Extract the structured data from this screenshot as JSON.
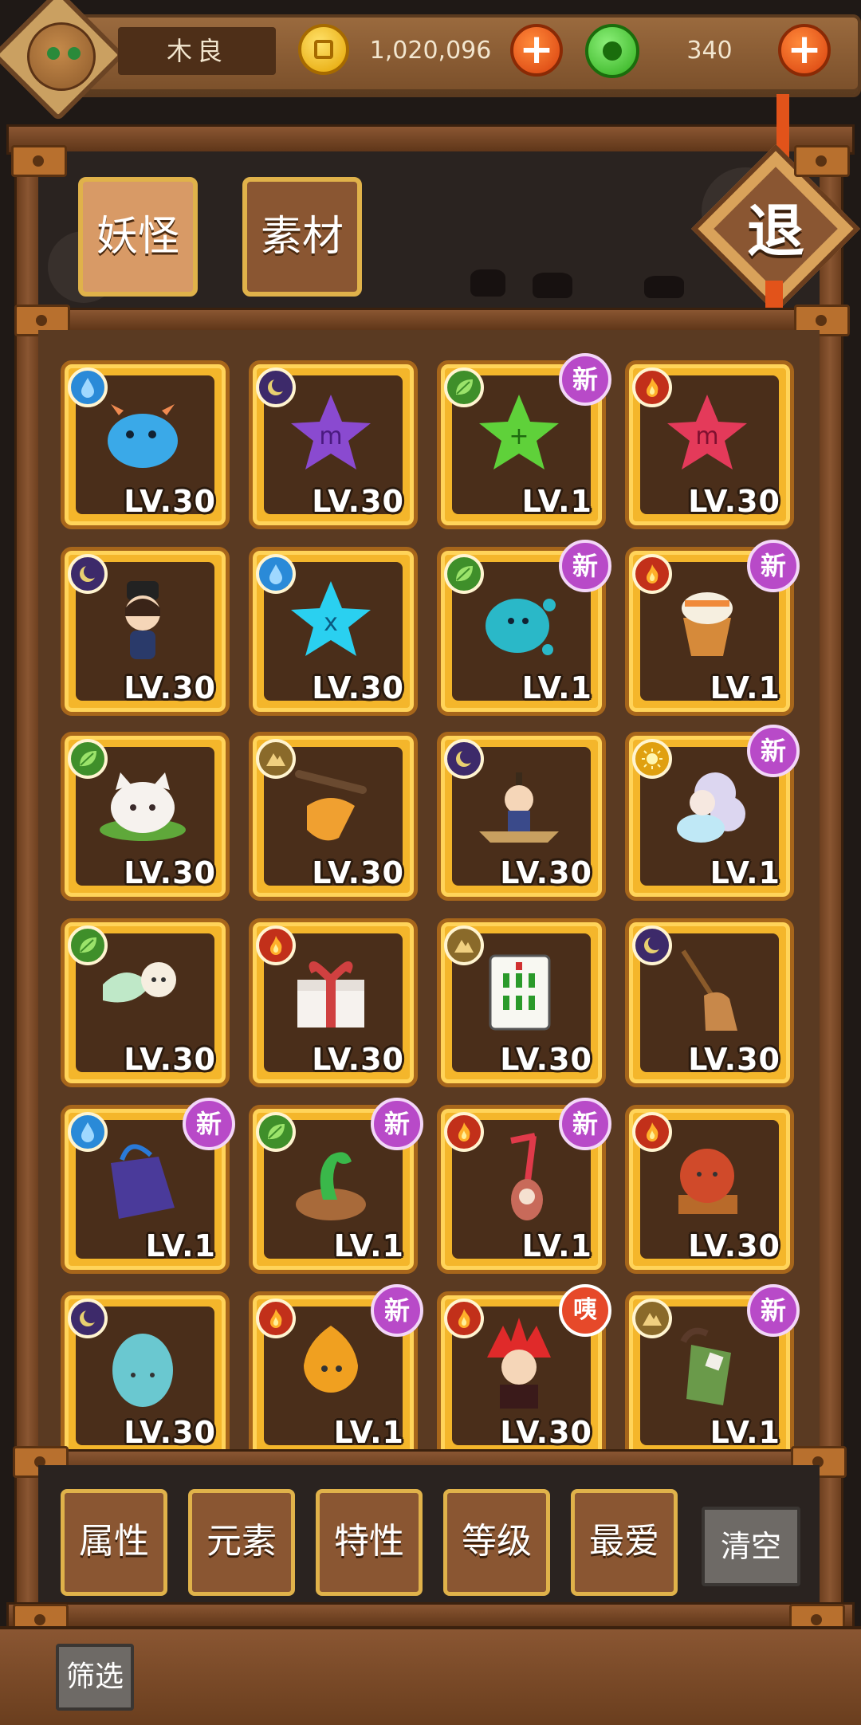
{
  "header": {
    "player_name": "木良",
    "coins": "1,020,096",
    "gems": "340",
    "plus_label": "+"
  },
  "tabs": [
    {
      "label": "妖怪",
      "active": true
    },
    {
      "label": "素材",
      "active": false
    }
  ],
  "exit_label": "退",
  "monsters": [
    {
      "element": "water",
      "level": "LV.30",
      "badge": "",
      "creature": "blue-fish-dragon"
    },
    {
      "element": "dark",
      "level": "LV.30",
      "badge": "",
      "creature": "purple-scorpio-star"
    },
    {
      "element": "leaf",
      "level": "LV.1",
      "badge": "新",
      "creature": "green-star"
    },
    {
      "element": "fire",
      "level": "LV.30",
      "badge": "",
      "creature": "red-virgo-star"
    },
    {
      "element": "dark",
      "level": "LV.30",
      "badge": "",
      "creature": "girl-with-hat"
    },
    {
      "element": "water",
      "level": "LV.30",
      "badge": "",
      "creature": "cyan-pisces-star"
    },
    {
      "element": "leaf",
      "level": "LV.1",
      "badge": "新",
      "creature": "teal-blob"
    },
    {
      "element": "fire",
      "level": "LV.1",
      "badge": "新",
      "creature": "drum-creature"
    },
    {
      "element": "leaf",
      "level": "LV.30",
      "badge": "",
      "creature": "white-cat-leaf"
    },
    {
      "element": "earth",
      "level": "LV.30",
      "badge": "",
      "creature": "branch-leaf"
    },
    {
      "element": "dark",
      "level": "LV.30",
      "badge": "",
      "creature": "boatman"
    },
    {
      "element": "light",
      "level": "LV.1",
      "badge": "新",
      "creature": "cloud-spirit"
    },
    {
      "element": "leaf",
      "level": "LV.30",
      "badge": "",
      "creature": "wind-spirit"
    },
    {
      "element": "fire",
      "level": "LV.30",
      "badge": "",
      "creature": "gift-box"
    },
    {
      "element": "earth",
      "level": "LV.30",
      "badge": "",
      "creature": "mahjong-tile"
    },
    {
      "element": "dark",
      "level": "LV.30",
      "badge": "",
      "creature": "broom"
    },
    {
      "element": "water",
      "level": "LV.1",
      "badge": "新",
      "creature": "purple-bag"
    },
    {
      "element": "leaf",
      "level": "LV.1",
      "badge": "新",
      "creature": "snake-pot"
    },
    {
      "element": "fire",
      "level": "LV.1",
      "badge": "新",
      "creature": "straw-creature"
    },
    {
      "element": "fire",
      "level": "LV.30",
      "badge": "",
      "creature": "red-ball-stand"
    },
    {
      "element": "dark",
      "level": "LV.30",
      "badge": "",
      "creature": "teal-egg"
    },
    {
      "element": "fire",
      "level": "LV.1",
      "badge": "新",
      "creature": "fire-spirit"
    },
    {
      "element": "fire",
      "level": "LV.30",
      "badge": "咦",
      "creature": "red-hair-hero"
    },
    {
      "element": "earth",
      "level": "LV.1",
      "badge": "新",
      "creature": "pipe-bag"
    }
  ],
  "filters": [
    {
      "label": "属性"
    },
    {
      "label": "元素"
    },
    {
      "label": "特性"
    },
    {
      "label": "等级"
    },
    {
      "label": "最爱"
    }
  ],
  "clear_label": "清空",
  "screen_label": "筛选",
  "colors": {
    "card_gold": "#f4b62b",
    "new_badge": "#b84ac8",
    "wood": "#8a5632"
  }
}
